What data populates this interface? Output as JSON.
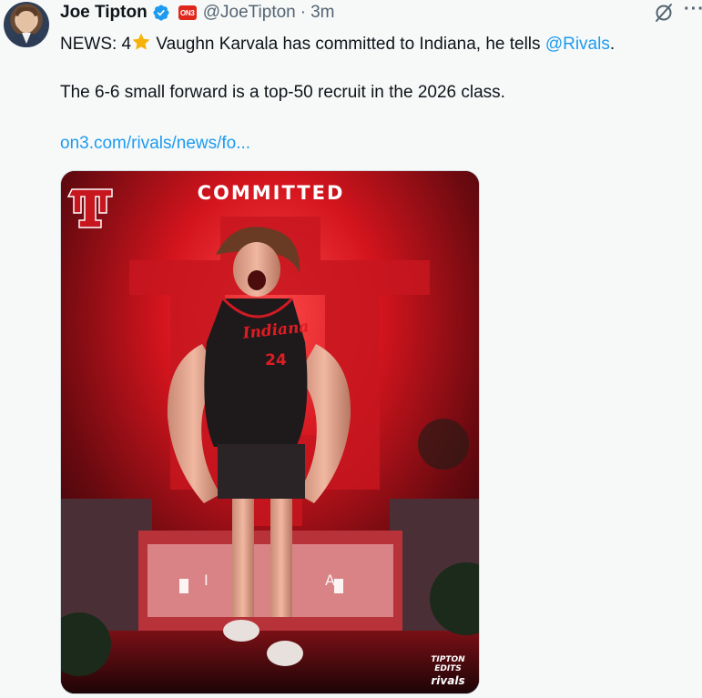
{
  "author": {
    "name": "Joe Tipton",
    "handle": "@JoeTipton",
    "separator": "·",
    "time": "3m",
    "affiliate_badge": "ON3"
  },
  "tweet": {
    "line1_prefix": "NEWS: 4",
    "line1_main": " Vaughn Karvala has committed to Indiana, he tells ",
    "line1_mention": "@Rivals",
    "line1_suffix": ".",
    "line2": "The 6-6 small forward is a top-50 recruit in the 2026 class.",
    "link": "on3.com/rivals/news/fo..."
  },
  "graphic": {
    "headline": "COMMITTED",
    "jersey_script": "Indiana",
    "jersey_number": "24",
    "building_letters": [
      "I",
      "A"
    ],
    "credit_line1": "TIPTON",
    "credit_line2": "EDITS",
    "credit_brand": "rivals"
  },
  "colors": {
    "text": "#0f1419",
    "secondary": "#536471",
    "link": "#1d9bf0",
    "verified": "#1d9bf0",
    "star": "#f6b20a",
    "graphic_red": "#e11b22",
    "background": "#f7f9f9"
  },
  "icons": [
    "verified-icon",
    "on3-badge",
    "grok-icon",
    "more-icon",
    "star-icon"
  ]
}
